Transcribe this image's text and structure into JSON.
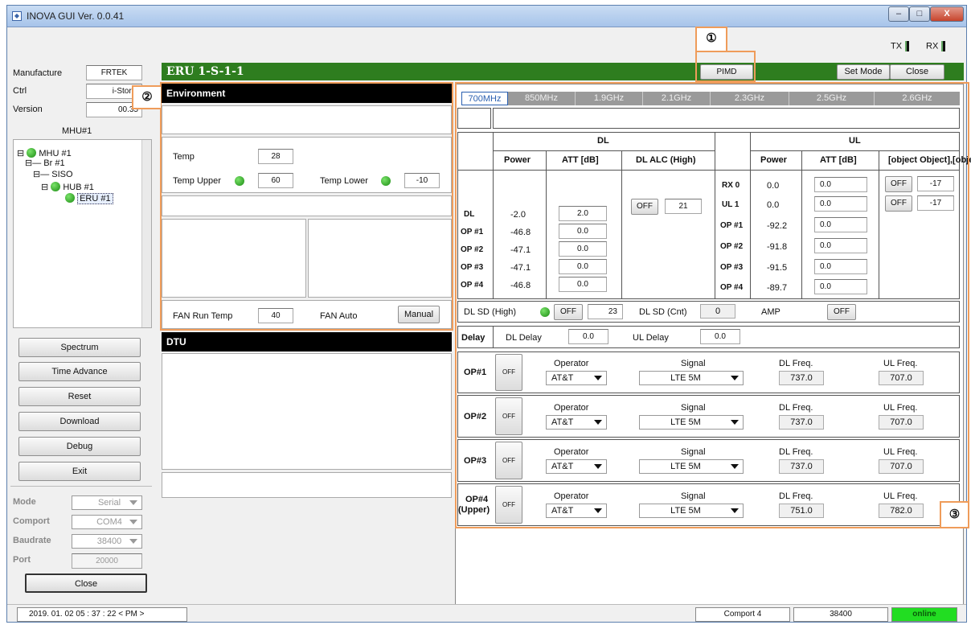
{
  "window": {
    "title": "INOVA GUI Ver. 0.0.41",
    "minimize": "–",
    "maximize": "□",
    "close": "X"
  },
  "indicators": {
    "tx": "TX",
    "rx": "RX"
  },
  "info": {
    "manufacture_label": "Manufacture",
    "manufacture": "FRTEK",
    "ctrl_label": "Ctrl",
    "ctrl": "i-Storm",
    "version_label": "Version",
    "version": "00.35",
    "mhu_title": "MHU#1"
  },
  "tree": [
    "MHU #1",
    "Br #1",
    "SISO",
    "HUB #1",
    "ERU #1"
  ],
  "side_buttons": [
    "Spectrum",
    "Time Advance",
    "Reset",
    "Download",
    "Debug",
    "Exit"
  ],
  "serial": {
    "mode_label": "Mode",
    "mode": "Serial",
    "comport_label": "Comport",
    "comport": "COM4",
    "baud_label": "Baudrate",
    "baud": "38400",
    "port_label": "Port",
    "port": "20000",
    "close": "Close"
  },
  "header": {
    "title": "ERU 1-S-1-1",
    "pimd": "PIMD",
    "set_mode": "Set Mode",
    "close": "Close"
  },
  "markers": [
    "①",
    "②",
    "③"
  ],
  "env": {
    "title": "Environment",
    "temp_label": "Temp",
    "temp": "28",
    "temp_upper_label": "Temp Upper",
    "temp_upper": "60",
    "temp_lower_label": "Temp Lower",
    "temp_lower": "-10",
    "fan_run_label": "FAN Run Temp",
    "fan_run": "40",
    "fan_auto_label": "FAN Auto",
    "manual": "Manual"
  },
  "dtu": {
    "title": "DTU"
  },
  "tabs": [
    "700MHz",
    "850MHz",
    "1.9GHz",
    "2.1GHz",
    "2.3GHz",
    "2.5GHz",
    "2.6GHz"
  ],
  "table": {
    "dl": "DL",
    "ul": "UL",
    "power": "Power",
    "att": "ATT [dB]",
    "dl_alc": "DL ALC (High)",
    "ul_alc": [
      {
        "btn": "OFF",
        "val": "-17"
      },
      {
        "btn": "OFF",
        "val": "-17"
      }
    ],
    "dl_rows": [
      {
        "n": "DL",
        "p": "-2.0",
        "a": "2.0"
      },
      {
        "n": "OP #1",
        "p": "-46.8",
        "a": "0.0"
      },
      {
        "n": "OP #2",
        "p": "-47.1",
        "a": "0.0"
      },
      {
        "n": "OP #3",
        "p": "-47.1",
        "a": "0.0"
      },
      {
        "n": "OP #4",
        "p": "-46.8",
        "a": "0.0"
      }
    ],
    "ul_rows": [
      {
        "n": "RX 0",
        "p": "0.0",
        "a": "0.0"
      },
      {
        "n": "UL 1",
        "p": "0.0",
        "a": "0.0"
      },
      {
        "n": "OP #1",
        "p": "-92.2",
        "a": "0.0"
      },
      {
        "n": "OP #2",
        "p": "-91.8",
        "a": "0.0"
      },
      {
        "n": "OP #3",
        "p": "-91.5",
        "a": "0.0"
      },
      {
        "n": "OP #4",
        "p": "-89.7",
        "a": "0.0"
      }
    ],
    "dl_alc_btn": "OFF",
    "dl_alc_val": "21"
  },
  "sd": {
    "dl_sd_label": "DL SD (High)",
    "dl_sd_btn": "OFF",
    "dl_sd_val": "23",
    "cnt_label": "DL SD (Cnt)",
    "cnt": "0",
    "amp_label": "AMP",
    "amp_btn": "OFF"
  },
  "delay": {
    "label": "Delay",
    "dl_label": "DL Delay",
    "dl": "0.0",
    "ul_label": "UL Delay",
    "ul": "0.0"
  },
  "ops": [
    {
      "name": "OP#1",
      "btn": "OFF",
      "op_label": "Operator",
      "op": "AT&T",
      "sig_label": "Signal",
      "sig": "LTE 5M",
      "dlf_label": "DL Freq.",
      "dlf": "737.0",
      "ulf_label": "UL Freq.",
      "ulf": "707.0"
    },
    {
      "name": "OP#2",
      "btn": "OFF",
      "op_label": "Operator",
      "op": "AT&T",
      "sig_label": "Signal",
      "sig": "LTE 5M",
      "dlf_label": "DL Freq.",
      "dlf": "737.0",
      "ulf_label": "UL Freq.",
      "ulf": "707.0"
    },
    {
      "name": "OP#3",
      "btn": "OFF",
      "op_label": "Operator",
      "op": "AT&T",
      "sig_label": "Signal",
      "sig": "LTE 5M",
      "dlf_label": "DL Freq.",
      "dlf": "737.0",
      "ulf_label": "UL Freq.",
      "ulf": "707.0"
    },
    {
      "name": "OP#4",
      "name2": "(Upper)",
      "btn": "OFF",
      "op_label": "Operator",
      "op": "AT&T",
      "sig_label": "Signal",
      "sig": "LTE 5M",
      "dlf_label": "DL Freq.",
      "dlf": "751.0",
      "ulf_label": "UL Freq.",
      "ulf": "782.0"
    }
  ],
  "statusbar": {
    "datetime": "2019. 01. 02   05 : 37 : 22 < PM >",
    "comport": "Comport 4",
    "baud": "38400",
    "online": "online"
  },
  "colors": {
    "online": "#22dd22",
    "header_green": "#2e7d1f",
    "highlight": "#ef9c5a"
  }
}
